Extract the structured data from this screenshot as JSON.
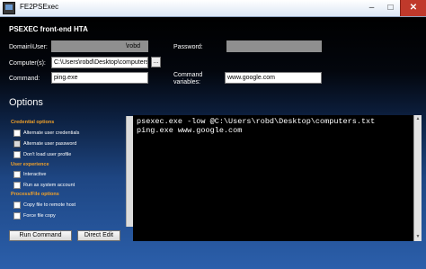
{
  "window": {
    "title": "FE2PSExec",
    "minimize": "–",
    "maximize": "□",
    "close": "✕"
  },
  "header": {
    "title": "PSEXEC front-end HTA"
  },
  "form": {
    "domain_user_label": "Domain\\User:",
    "domain_user_value": "\\robd",
    "password_label": "Password:",
    "password_value": "",
    "computers_label": "Computer(s):",
    "computers_value": "C:\\Users\\robd\\Desktop\\computers",
    "browse_label": "...",
    "command_label": "Command:",
    "command_value": "ping.exe",
    "cmd_vars_label_line1": "Command",
    "cmd_vars_label_line2": "variables:",
    "cmd_vars_value": "www.google.com"
  },
  "options": {
    "title": "Options",
    "sections": [
      {
        "title": "Credential options",
        "items": [
          "Alternate user credentials",
          "Alternate user password",
          "Don't load user profile"
        ]
      },
      {
        "title": "User experience",
        "items": [
          "Interactive",
          "Run as system account"
        ]
      },
      {
        "title": "Process/File options",
        "items": [
          "Copy file to remote host",
          "Force file copy"
        ]
      }
    ]
  },
  "buttons": {
    "run": "Run Command",
    "direct_edit": "Direct Edit"
  },
  "console": {
    "lines": [
      "psexec.exe -low @C:\\Users\\robd\\Desktop\\computers.txt",
      "ping.exe www.google.com"
    ]
  },
  "icons": {
    "app": "app-icon",
    "browse": "ellipsis-icon"
  }
}
